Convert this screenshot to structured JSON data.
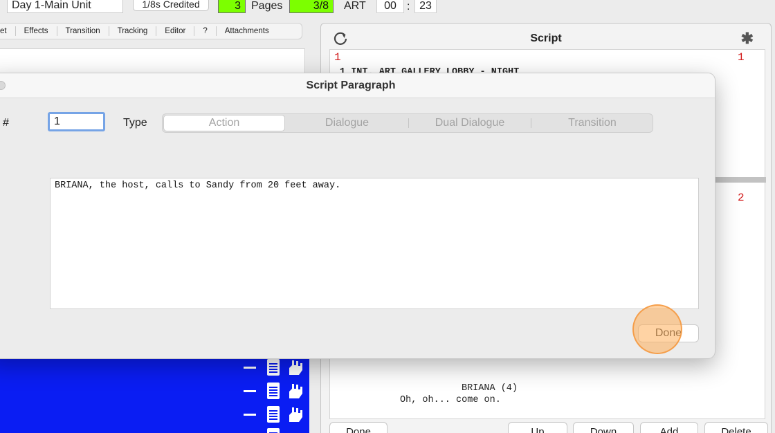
{
  "toolbar": {
    "unit_name": "Day 1-Main Unit",
    "credited_label": "1/8s Credited",
    "pages_whole": "3",
    "pages_label": "Pages",
    "pages_fraction": "3/8",
    "department": "ART",
    "time_minutes": "00",
    "time_separator": ":",
    "time_seconds": "23"
  },
  "left_tabs": [
    {
      "label": "et"
    },
    {
      "label": "Effects"
    },
    {
      "label": "Transition"
    },
    {
      "label": "Tracking"
    },
    {
      "label": "Editor"
    },
    {
      "label": "?"
    },
    {
      "label": "Attachments"
    }
  ],
  "script_panel": {
    "title": "Script",
    "asterisk": "✱",
    "scene_number_left": "1",
    "scene_number_right": "1",
    "scene_heading": "1 INT. ART GALLERY LOBBY - NIGHT",
    "scene_number_2": "2",
    "character_line": "BRIANA  (4)",
    "dialogue_line": "Oh, oh... come on.",
    "buttons": {
      "done": "Done",
      "up": "Up",
      "down": "Down",
      "add": "Add",
      "delete": "Delete"
    }
  },
  "modal": {
    "title": "Script Paragraph",
    "number_label": "#",
    "number_value": "1",
    "type_label": "Type",
    "type_options": [
      "Action",
      "Dialogue",
      "Dual Dialogue",
      "Transition"
    ],
    "selected_type": "Action",
    "paragraph_text": "BRIANA, the host, calls to Sandy from 20 feet away.",
    "done_label": "Done"
  },
  "colors": {
    "green_highlight": "#7cff00",
    "blue_panel": "#0a1df3",
    "scene_number_red": "#d21a1a",
    "focus_ring": "#76a4e6",
    "click_indicator": "#ffaf5a"
  }
}
